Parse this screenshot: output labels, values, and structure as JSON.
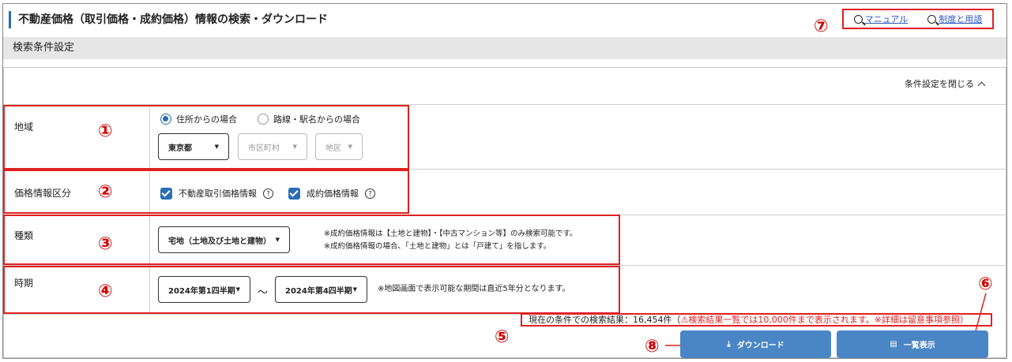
{
  "header": {
    "title": "不動産価格（取引価格・成約価格）情報の検索・ダウンロード",
    "links": {
      "manual": "マニュアル",
      "terms": "制度と用語"
    }
  },
  "condition_bar": "検索条件設定",
  "close_toggle": "条件設定を閉じる",
  "markers": {
    "n1": "①",
    "n2": "②",
    "n3": "③",
    "n4": "④",
    "n5": "⑤",
    "n6": "⑥",
    "n7": "⑦",
    "n8": "⑧"
  },
  "region": {
    "label": "地域",
    "radio_address": "住所からの場合",
    "radio_station": "路線・駅名からの場合",
    "selected_radio": "住所からの場合",
    "prefecture": "東京都",
    "city_placeholder": "市区町村",
    "district_placeholder": "地区"
  },
  "price_info": {
    "label": "価格情報区分",
    "transaction": "不動産取引価格情報",
    "contract": "成約価格情報",
    "transaction_checked": true,
    "contract_checked": true
  },
  "kind": {
    "label": "種類",
    "selected": "宅地（土地及び土地と建物）",
    "note1": "※成約価格情報は【土地と建物】・【中古マンション等】のみ検索可能です。",
    "note2": "※成約価格情報の場合、「土地と建物」とは「戸建て」を指します。"
  },
  "period": {
    "label": "時期",
    "from": "2024年第1四半期",
    "tilde": "～",
    "to": "2024年第4四半期",
    "note": "※地図画面で表示可能な期間は直近5年分となります。"
  },
  "result": {
    "prefix": "現在の条件での検索結果：16,454件（",
    "warning": "検索結果一覧では10,000件まで表示されます。※詳細は留意事項参照）"
  },
  "buttons": {
    "download": "ダウンロード",
    "list": "一覧表示"
  },
  "colors": {
    "accent": "#2a6fb5",
    "button": "#4a86c6",
    "annotation": "#e02020"
  }
}
